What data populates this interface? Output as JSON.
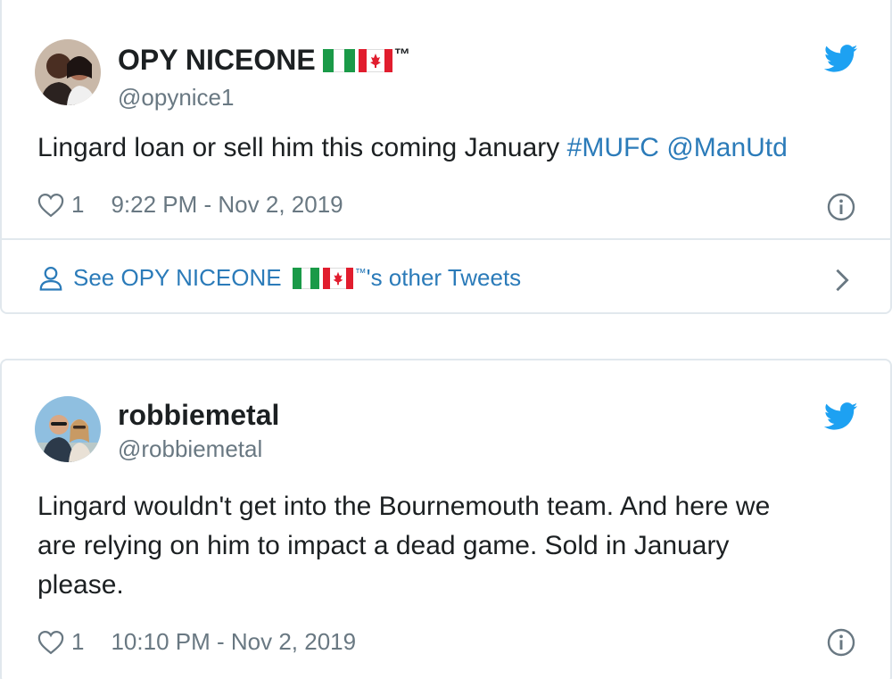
{
  "tweets": [
    {
      "name": "OPY NICEONE",
      "tm": "™",
      "handle": "@opynice1",
      "text": "Lingard loan or sell him this coming January ",
      "hashtag": "#MUFC",
      "mention": "@ManUtd",
      "likes": "1",
      "timestamp": "9:22 PM - Nov 2, 2019",
      "see_more_prefix": "See OPY NICEONE",
      "see_more_suffix": "'s other Tweets"
    },
    {
      "name": "robbiemetal",
      "handle": "@robbiemetal",
      "text_line1": "Lingard wouldn't get into the Bournemouth team. And here we",
      "text_line2": "are relying on him to impact a dead game. Sold in January",
      "text_line3": "please.",
      "likes": "1",
      "timestamp": "10:10 PM - Nov 2, 2019"
    }
  ],
  "colors": {
    "link": "#2b7bb9",
    "twitter_blue": "#1da1f2",
    "muted": "#697882",
    "border": "#e1e8ed"
  },
  "icons": {
    "twitter_logo": "twitter-bird-icon",
    "like": "heart-icon",
    "info": "info-icon",
    "profile": "person-icon",
    "more": "chevron-right-icon",
    "flags": [
      "nigeria-flag",
      "canada-flag"
    ]
  }
}
